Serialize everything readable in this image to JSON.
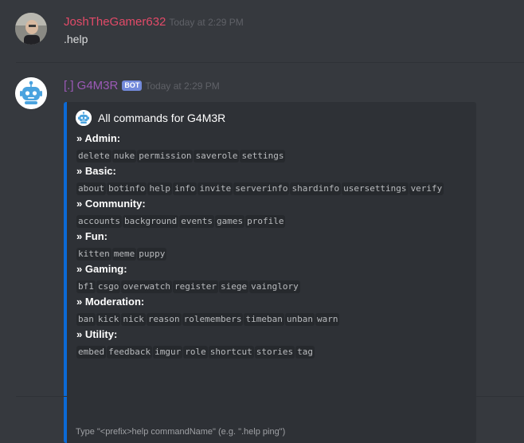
{
  "messages": [
    {
      "username": "JoshTheGamer632",
      "timestamp": "Today at 2:29 PM",
      "content": ".help",
      "username_color": "#e24a68"
    },
    {
      "username": "[.] G4M3R",
      "bot_tag": "BOT",
      "timestamp": "Today at 2:29 PM",
      "username_color": "#9b59b6"
    }
  ],
  "embed": {
    "color": "#0b6ad6",
    "author": "All commands for G4M3R",
    "fields": [
      {
        "name": "» Admin:",
        "commands": [
          "delete",
          "nuke",
          "permission",
          "saverole",
          "settings"
        ]
      },
      {
        "name": "» Basic:",
        "commands": [
          "about",
          "botinfo",
          "help",
          "info",
          "invite",
          "serverinfo",
          "shardinfo",
          "usersettings",
          "verify"
        ]
      },
      {
        "name": "» Community:",
        "commands": [
          "accounts",
          "background",
          "events",
          "games",
          "profile"
        ]
      },
      {
        "name": "» Fun:",
        "commands": [
          "kitten",
          "meme",
          "puppy"
        ]
      },
      {
        "name": "» Gaming:",
        "commands": [
          "bf1",
          "csgo",
          "overwatch",
          "register",
          "siege",
          "vainglory"
        ]
      },
      {
        "name": "» Moderation:",
        "commands": [
          "ban",
          "kick",
          "nick",
          "reason",
          "rolemembers",
          "timeban",
          "unban",
          "warn"
        ]
      },
      {
        "name": "» Utility:",
        "commands": [
          "embed",
          "feedback",
          "imgur",
          "role",
          "shortcut",
          "stories",
          "tag"
        ]
      }
    ],
    "footer": "Type \"<prefix>help commandName\" (e.g. \".help ping\")"
  }
}
